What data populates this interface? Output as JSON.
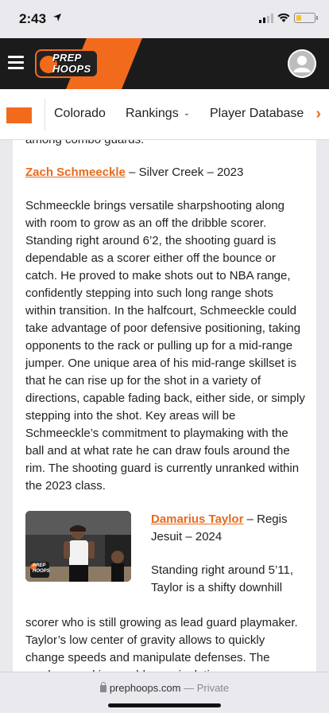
{
  "status": {
    "time": "2:43"
  },
  "header": {
    "logo_line1": "PREP",
    "logo_line2": "HOOPS",
    "brand_color": "#f26b1d"
  },
  "nav": {
    "items": [
      {
        "label": "Colorado"
      },
      {
        "label": "Rankings"
      },
      {
        "label": "Player Database"
      }
    ]
  },
  "article": {
    "prev_tail": "among combo guards.",
    "player1": {
      "name": "Zach Schmeeckle",
      "details": " – Silver Creek – 2023",
      "paragraph": "Schmeeckle brings versatile sharpshooting along with room to grow as an off the dribble scorer. Standing right around 6’2, the shooting guard is dependable as a scorer either off the bounce or catch. He proved to make shots out to NBA range, confidently stepping into such long range shots within transition. In the halfcourt, Schmeeckle could take advantage of poor defensive positioning, taking opponents to the rack or pulling up for a mid-range jumper. One unique area of his mid-range skillset is that he can rise up for the shot in a variety of directions, capable fading back, either side, or simply stepping into the shot. Key areas will be Schmeeckle’s commitment to playmaking with the ball and at what rate he can draw fouls around the rim. The shooting guard is currently unranked within the 2023 class."
    },
    "player2": {
      "name": "Damarius Taylor",
      "details": " – Regis Jesuit – 2024",
      "para_float": "Standing right around 5’11, Taylor is a shifty downhill",
      "para_full": "scorer who is still growing as lead guard playmaker. Taylor’s low center of gravity allows to quickly change speeds and manipulate defenses. The combo guard is capable manipulating"
    },
    "photo_watermark_1": "PREP",
    "photo_watermark_2": "HOOPS"
  },
  "browser": {
    "url": "prephoops.com",
    "separator": " — ",
    "mode": "Private"
  }
}
